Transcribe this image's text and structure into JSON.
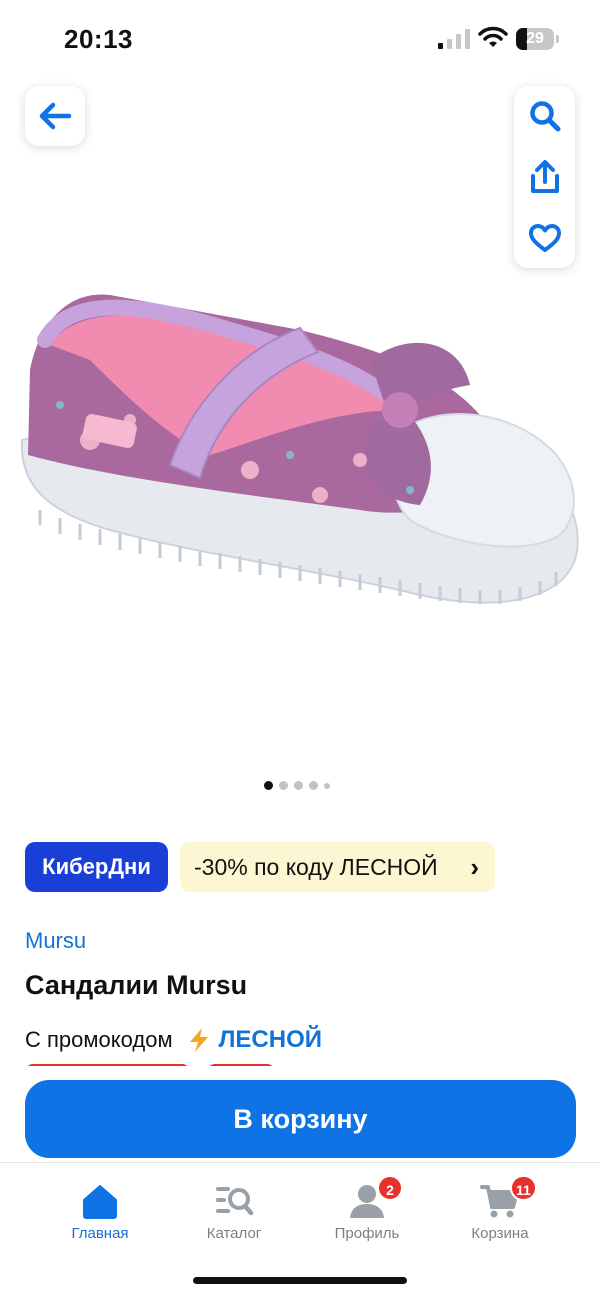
{
  "status_bar": {
    "time": "20:13",
    "battery_level": "29",
    "battery_fraction": 0.29
  },
  "header": {
    "back_icon": "arrow-left-icon",
    "tools": [
      "search-icon",
      "share-icon",
      "heart-icon"
    ]
  },
  "gallery": {
    "image_alt": "Сандалии Mursu",
    "slides_count": 5,
    "active_slide": 1
  },
  "promo": {
    "badge": "КиберДни",
    "offer": "-30% по коду ЛЕСНОЙ",
    "chevron": "›"
  },
  "product": {
    "brand": "Mursu",
    "title": "Сандалии Mursu",
    "promo_prefix": "С промокодом",
    "promo_code": "ЛЕСНОЙ"
  },
  "cta": {
    "add_to_cart": "В корзину"
  },
  "tabbar": {
    "items": [
      {
        "label": "Главная",
        "icon": "home-icon",
        "active": true
      },
      {
        "label": "Каталог",
        "icon": "catalog-search-icon",
        "active": false
      },
      {
        "label": "Профиль",
        "icon": "profile-icon",
        "badge": "2",
        "active": false
      },
      {
        "label": "Корзина",
        "icon": "cart-icon",
        "badge": "11",
        "active": false
      }
    ]
  },
  "colors": {
    "accent": "#0f72e5",
    "link": "#1273d6",
    "cyber_badge": "#1a3fd6",
    "promo_bg": "#fdf6d3",
    "badge_red": "#e8312a"
  }
}
